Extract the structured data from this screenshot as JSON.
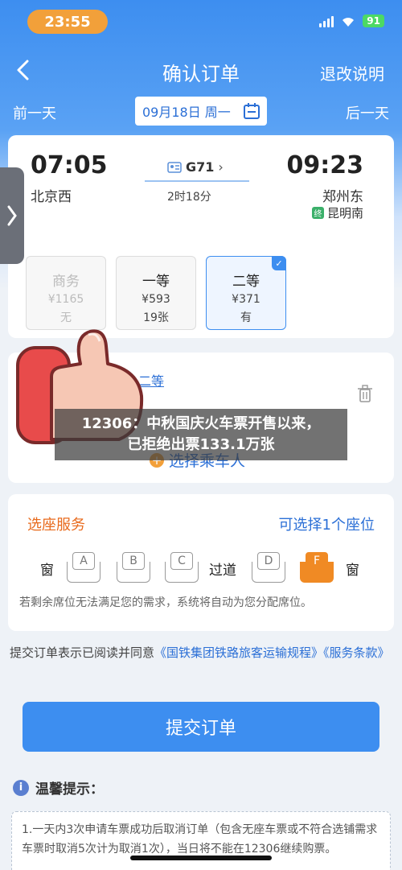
{
  "status": {
    "time": "23:55",
    "battery": "91"
  },
  "nav": {
    "title": "确认订单",
    "right_link": "退改说明"
  },
  "date_bar": {
    "prev": "前一天",
    "date": "09月18日 周一",
    "next": "后一天"
  },
  "train": {
    "departure_time": "07:05",
    "departure_station": "北京西",
    "train_number": "G71",
    "duration": "2时18分",
    "arrival_time": "09:23",
    "arrival_station": "郑州东",
    "final_badge": "终",
    "final_station": "昆明南"
  },
  "seat_classes": [
    {
      "name": "商务",
      "price": "¥1165",
      "availability": "无",
      "state": "disabled"
    },
    {
      "name": "一等",
      "price": "¥593",
      "availability": "19张",
      "state": "normal"
    },
    {
      "name": "二等",
      "price": "¥371",
      "availability": "有",
      "state": "selected"
    }
  ],
  "passenger": {
    "seat_tag": "二等",
    "add_label": "选择乘车人"
  },
  "caption": {
    "line1": "12306：中秋国庆火车票开售以来，",
    "line2": "已拒绝出票133.1万张"
  },
  "seat_service": {
    "title": "选座服务",
    "hint": "可选择1个座位",
    "window_left": "窗",
    "aisle": "过道",
    "window_right": "窗",
    "seats": [
      "A",
      "B",
      "C",
      "D",
      "F"
    ],
    "selected_seat": "F",
    "note": "若剩余席位无法满足您的需求，系统将自动为您分配席位。"
  },
  "agreement": {
    "prefix": "提交订单表示已阅读并同意",
    "link1": "《国铁集团铁路旅客运输规程》",
    "link2": "《服务条款》"
  },
  "submit_label": "提交订单",
  "tips": {
    "title": "温馨提示：",
    "text": "1.一天内3次申请车票成功后取消订单（包含无座车票或不符合选铺需求车票时取消5次计为取消1次），当日将不能在12306继续购票。"
  },
  "colors": {
    "primary": "#3d8ef0",
    "accent_orange": "#f08a24",
    "time_pill": "#f2a03a"
  },
  "icons": [
    "back-icon",
    "calendar-icon",
    "ticket-icon",
    "trash-icon",
    "plus-icon",
    "info-icon",
    "thumbs-up-icon"
  ]
}
